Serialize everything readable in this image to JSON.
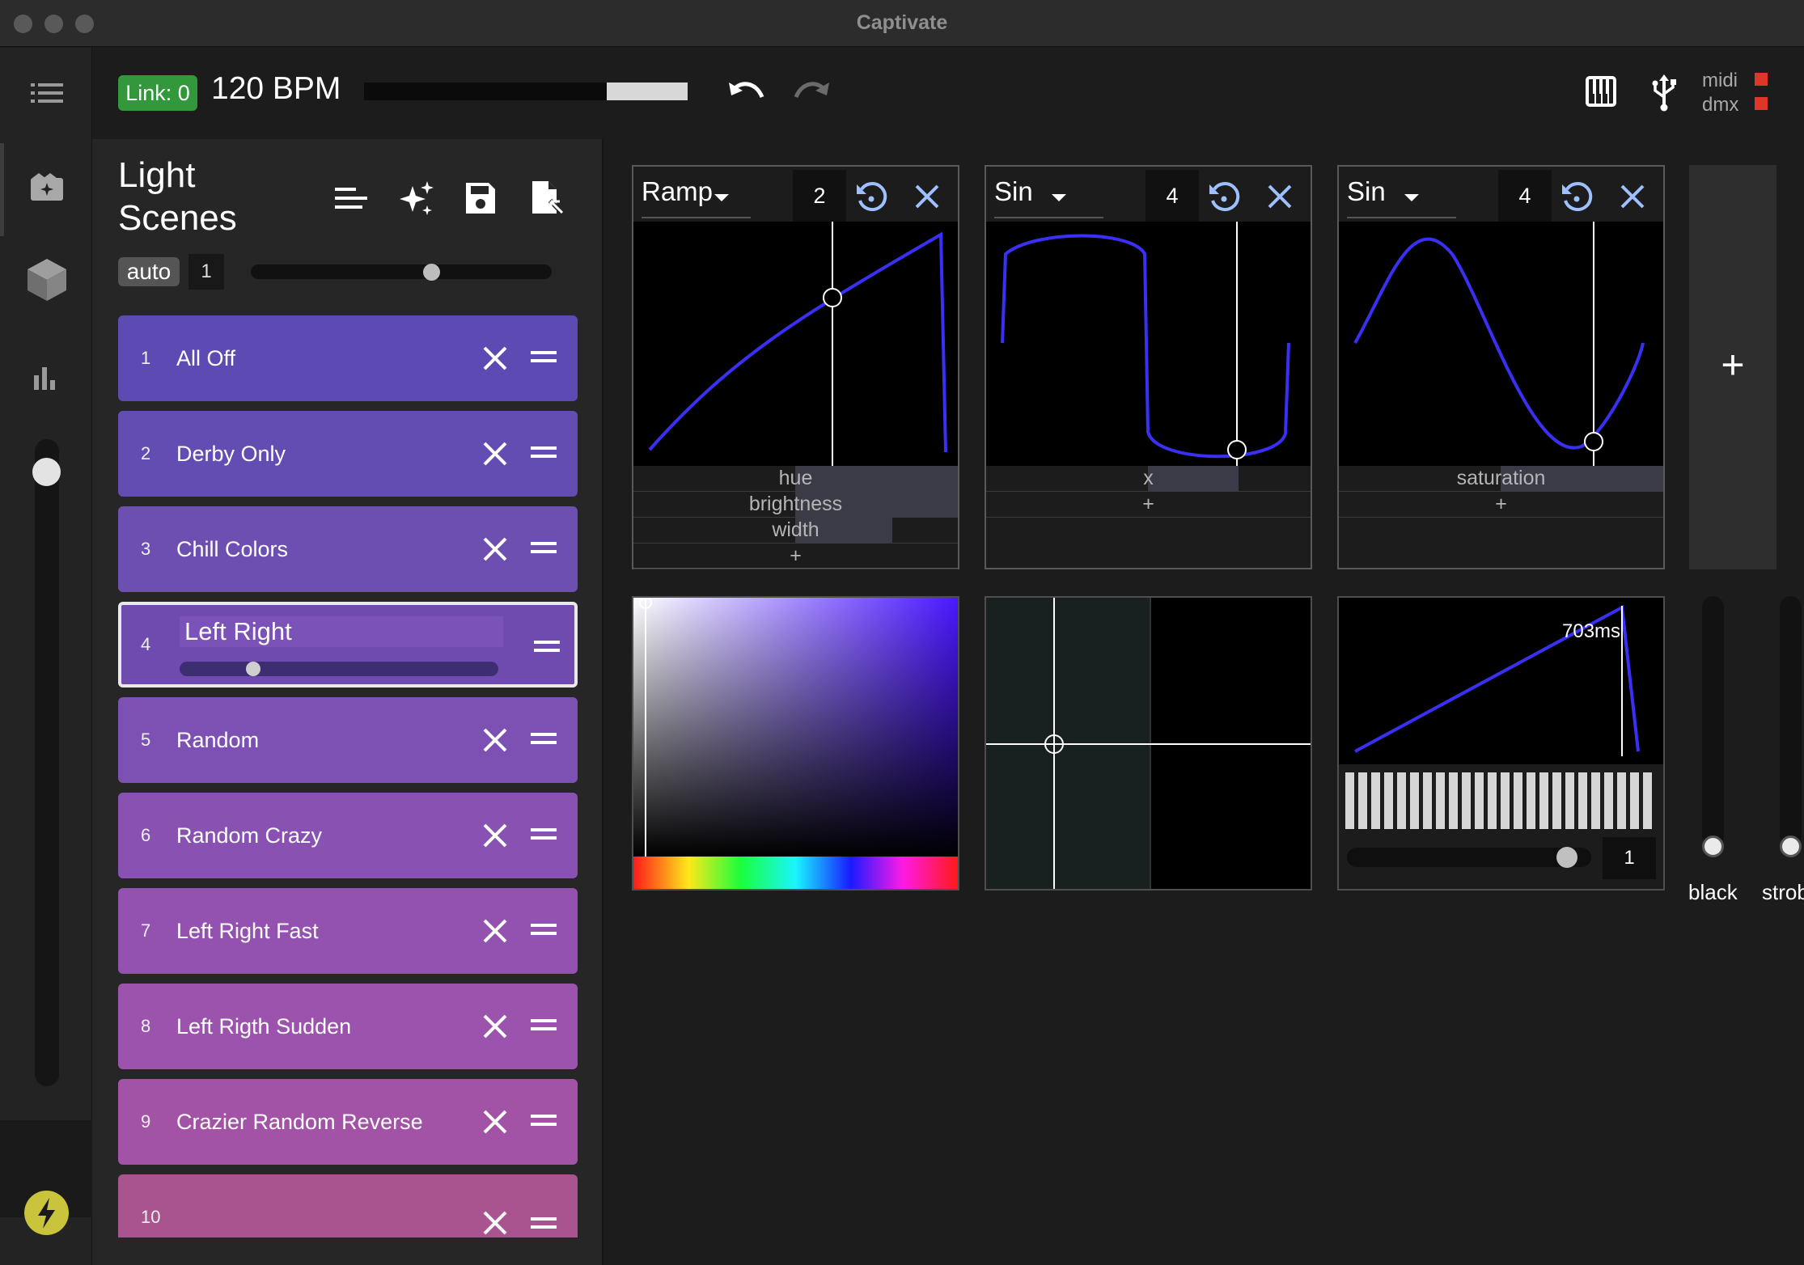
{
  "window": {
    "title": "Captivate"
  },
  "toolbar": {
    "link_label": "Link: 0",
    "bpm_label": "120 BPM",
    "beat_progress": 0.25,
    "io": [
      {
        "label": "midi",
        "status_color": "#e0352b"
      },
      {
        "label": "dmx",
        "status_color": "#e0352b"
      }
    ]
  },
  "sidebar": {
    "icons": [
      "menu-icon",
      "scenes-icon",
      "cube-icon",
      "bar-chart-icon"
    ],
    "master_level": 0.95
  },
  "scenes": {
    "title": "Light Scenes",
    "auto_label": "auto",
    "auto_value": "1",
    "auto_slider": 0.6,
    "items": [
      {
        "num": "1",
        "name": "All Off",
        "color": "#5d4bb3"
      },
      {
        "num": "2",
        "name": "Derby Only",
        "color": "#634db2"
      },
      {
        "num": "3",
        "name": "Chill Colors",
        "color": "#6d4fb2"
      },
      {
        "num": "4",
        "name": "Left Right",
        "color": "#6f4bb0",
        "selected": true,
        "slider": 0.23
      },
      {
        "num": "5",
        "name": "Random",
        "color": "#7d51b3"
      },
      {
        "num": "6",
        "name": "Random Crazy",
        "color": "#8951b2"
      },
      {
        "num": "7",
        "name": "Left Right Fast",
        "color": "#9452b0"
      },
      {
        "num": "8",
        "name": "Left Rigth Sudden",
        "color": "#9b53ad"
      },
      {
        "num": "9",
        "name": "Crazier Random Reverse",
        "color": "#a353a6"
      },
      {
        "num": "10",
        "name": "",
        "color": "#a9538f"
      }
    ]
  },
  "modulators": [
    {
      "type": "Ramp",
      "period": "2",
      "rows": [
        {
          "label": "hue",
          "fill": 0.5
        },
        {
          "label": "brightness",
          "fill": 0.5
        },
        {
          "label": "width",
          "fill": 0.3
        }
      ],
      "add_label": "+"
    },
    {
      "type": "Sin",
      "period": "4",
      "rows": [
        {
          "label": "x",
          "fill": 0.28
        }
      ],
      "add_label": "+"
    },
    {
      "type": "Sin",
      "period": "4",
      "rows": [
        {
          "label": "saturation",
          "fill": 0.5
        }
      ],
      "add_label": "+"
    }
  ],
  "add_modulator_label": "+",
  "strobe_widget": {
    "time_label": "703ms",
    "value": "1",
    "slider": 0.9
  },
  "faders": [
    {
      "label": "black",
      "level": 0.0
    },
    {
      "label": "strobe",
      "level": 0.0
    }
  ]
}
